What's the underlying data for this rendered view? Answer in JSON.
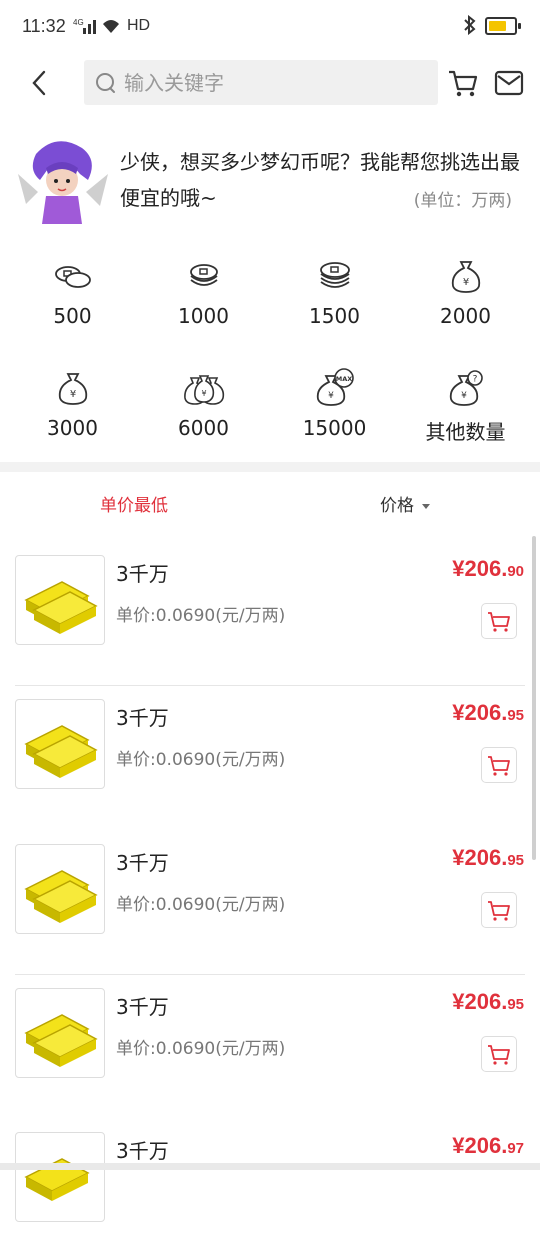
{
  "status": {
    "time": "11:32",
    "network": "HD"
  },
  "header": {
    "search_placeholder": "输入关键字"
  },
  "intro": {
    "message": "少侠，想买多少梦幻币呢？我能帮您挑选出最便宜的哦~",
    "unit_note": "(单位：万两)"
  },
  "quick_amounts": [
    {
      "label": "500",
      "icon": "coins-stack-icon"
    },
    {
      "label": "1000",
      "icon": "coins-stack-icon"
    },
    {
      "label": "1500",
      "icon": "coins-pile-icon"
    },
    {
      "label": "2000",
      "icon": "money-bag-icon"
    },
    {
      "label": "3000",
      "icon": "money-bag-icon"
    },
    {
      "label": "6000",
      "icon": "money-bags-icon"
    },
    {
      "label": "15000",
      "icon": "money-bag-max-icon"
    },
    {
      "label": "其他数量",
      "icon": "money-bag-question-icon"
    }
  ],
  "sort": {
    "lowest_label": "单价最低",
    "price_label": "价格"
  },
  "products": [
    {
      "name": "3千万",
      "unit_price": "单价:0.0690(元/万两)",
      "price_symbol": "¥",
      "price_int": "206.",
      "price_dec": "90"
    },
    {
      "name": "3千万",
      "unit_price": "单价:0.0690(元/万两)",
      "price_symbol": "¥",
      "price_int": "206.",
      "price_dec": "95"
    },
    {
      "name": "3千万",
      "unit_price": "单价:0.0690(元/万两)",
      "price_symbol": "¥",
      "price_int": "206.",
      "price_dec": "95"
    },
    {
      "name": "3千万",
      "unit_price": "单价:0.0690(元/万两)",
      "price_symbol": "¥",
      "price_int": "206.",
      "price_dec": "95"
    },
    {
      "name": "3千万",
      "unit_price": "",
      "price_symbol": "¥",
      "price_int": "206.",
      "price_dec": "97"
    }
  ],
  "colors": {
    "accent": "#e0313c",
    "icon": "#333333"
  }
}
